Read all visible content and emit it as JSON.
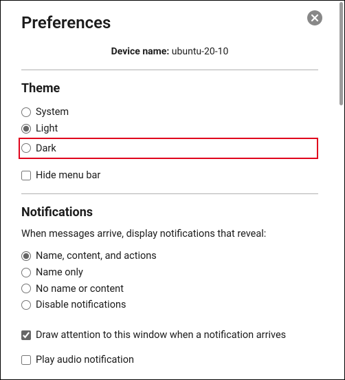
{
  "title": "Preferences",
  "device_label": "Device name:",
  "device_name": "ubuntu-20-10",
  "theme": {
    "title": "Theme",
    "system": "System",
    "light": "Light",
    "dark": "Dark",
    "hide_menu": "Hide menu bar",
    "selected": "light",
    "hide_menu_checked": false
  },
  "notifications": {
    "title": "Notifications",
    "subhead": "When messages arrive, display notifications that reveal:",
    "o1": "Name, content, and actions",
    "o2": "Name only",
    "o3": "No name or content",
    "o4": "Disable notifications",
    "selected": "o1",
    "draw_attention": "Draw attention to this window when a notification arrives",
    "draw_attention_checked": true,
    "play_audio": "Play audio notification",
    "play_audio_checked": false
  },
  "highlight": "dark"
}
